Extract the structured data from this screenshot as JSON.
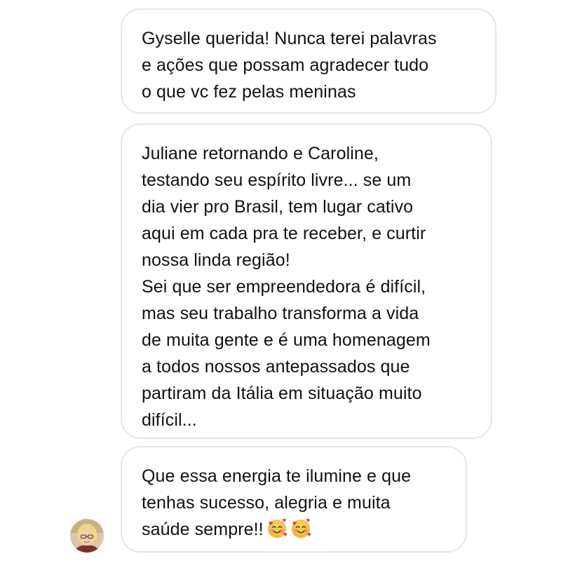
{
  "conversation": {
    "messages": [
      {
        "paragraphs": [
          {
            "lines": [
              "Gyselle querida! Nunca terei palavras",
              "e ações que possam agradecer tudo",
              "o que vc fez pelas meninas"
            ]
          }
        ]
      },
      {
        "paragraphs": [
          {
            "lines": [
              "Juliane retornando e Caroline,",
              "testando seu espírito livre... se um",
              "dia vier pro Brasil, tem lugar cativo",
              "aqui em cada pra te receber, e curtir",
              "nossa linda região!"
            ]
          },
          {
            "lines": [
              "Sei que ser empreendedora é difícil,",
              "mas seu trabalho transforma a vida",
              "de muita gente e é uma homenagem",
              "a todos nossos antepassados que",
              "partiram da Itália em situação muito",
              "difícil..."
            ]
          }
        ]
      },
      {
        "paragraphs": [
          {
            "lines": [
              "Que essa energia te ilumine e que",
              "tenhas sucesso, alegria e muita",
              "saúde sempre!!"
            ],
            "trailing_emoji": [
              "smiling-face-with-hearts-icon",
              "smiling-face-with-hearts-icon"
            ]
          }
        ]
      }
    ],
    "sender_avatar": "avatar"
  },
  "colors": {
    "bubble_border": "#e6e6e6",
    "text": "#111111",
    "background": "#ffffff"
  }
}
